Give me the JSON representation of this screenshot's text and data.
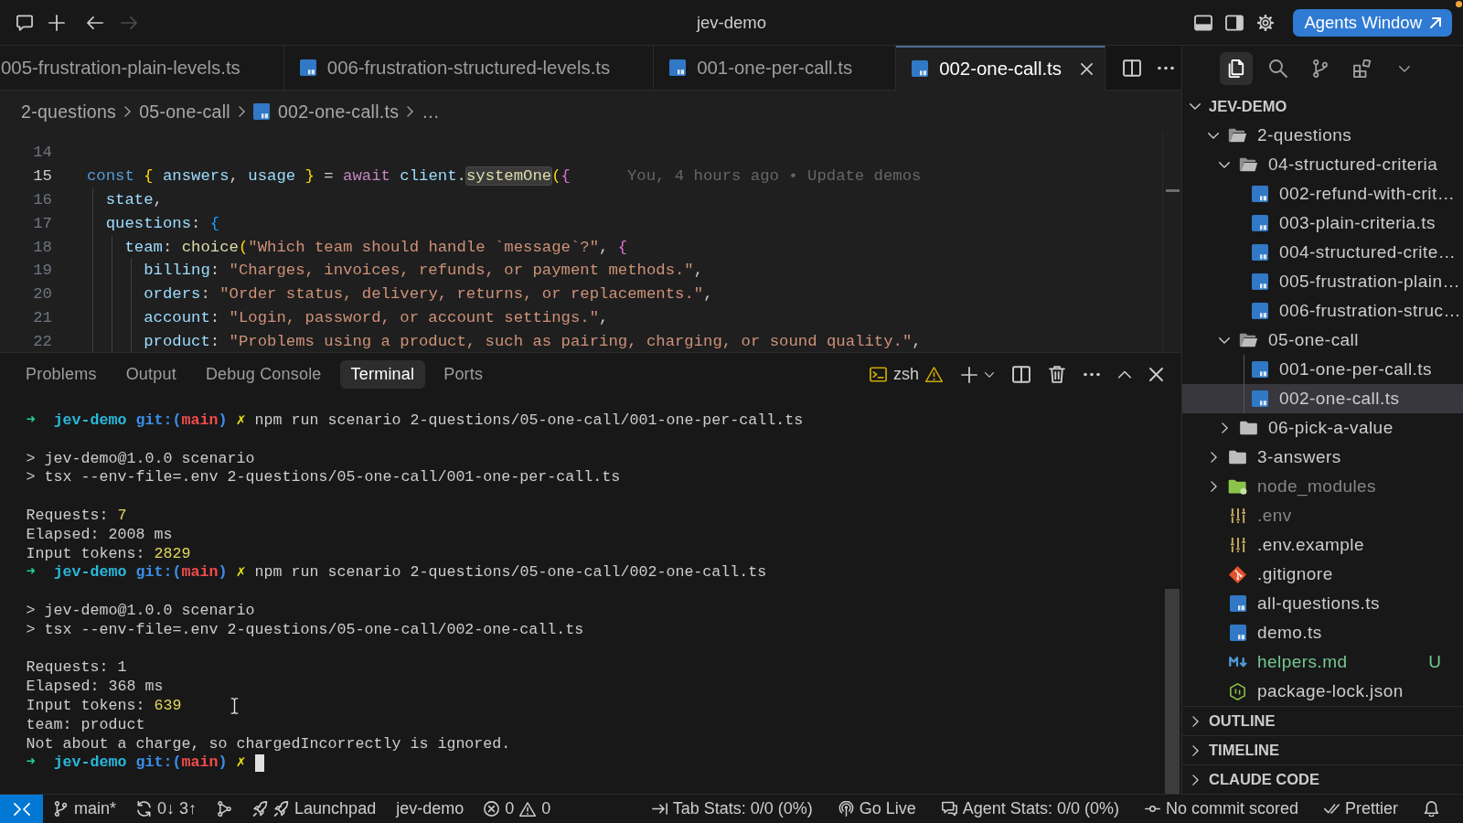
{
  "title_bar": {
    "left_actions": [
      {
        "kind": "chat",
        "disabled": false
      },
      {
        "kind": "new",
        "disabled": false
      },
      {
        "kind": "back",
        "disabled": false
      },
      {
        "kind": "forward",
        "disabled": true
      }
    ],
    "title": "jev-demo",
    "right_actions": [
      {
        "kind": "panel"
      },
      {
        "kind": "sidebar"
      },
      {
        "kind": "settings"
      }
    ],
    "agents_button": {
      "label": "Agents Window",
      "notification": true
    }
  },
  "editor": {
    "tabs": [
      {
        "label": "005-frustration-plain-levels.ts",
        "kind": "clipped",
        "selected": false
      },
      {
        "label": "006-frustration-structured-levels.ts",
        "kind": "file",
        "selected": false
      },
      {
        "label": "001-one-per-call.ts",
        "kind": "file",
        "selected": false
      },
      {
        "label": "002-one-call.ts",
        "kind": "file",
        "selected": true
      }
    ],
    "breadcrumbs": [
      {
        "label": "2-questions",
        "kind": "folder"
      },
      {
        "label": "05-one-call",
        "kind": "folder"
      },
      {
        "label": "002-one-call.ts",
        "kind": "file"
      },
      {
        "label": "…",
        "kind": "ellipsis"
      }
    ],
    "lines": [
      {
        "number": "14",
        "current": false
      },
      {
        "number": "15",
        "current": true,
        "tokens": [
          {
            "kind": "keyword",
            "text": "const "
          },
          {
            "kind": "bracket1",
            "text": "{"
          },
          {
            "kind": "variable",
            "text": " answers"
          },
          {
            "kind": "plain",
            "text": ", "
          },
          {
            "kind": "variable",
            "text": "usage "
          },
          {
            "kind": "bracket1",
            "text": "}"
          },
          {
            "kind": "plain",
            "text": " = "
          },
          {
            "kind": "control",
            "text": "await"
          },
          {
            "kind": "variable",
            "text": " client"
          },
          {
            "kind": "plain",
            "text": "."
          },
          {
            "kind": "match",
            "text": "systemOne"
          },
          {
            "kind": "bracket1",
            "text": "("
          },
          {
            "kind": "bracket2",
            "text": "{"
          }
        ],
        "blame": "You, 4 hours ago • Update demos"
      },
      {
        "number": "16",
        "current": false,
        "tokens": [
          {
            "kind": "variable",
            "text": "  state"
          },
          {
            "kind": "plain",
            "text": ","
          }
        ]
      },
      {
        "number": "17",
        "current": false,
        "tokens": [
          {
            "kind": "variable",
            "text": "  questions"
          },
          {
            "kind": "plain",
            "text": ": "
          },
          {
            "kind": "bracket3",
            "text": "{"
          }
        ]
      },
      {
        "number": "18",
        "current": false,
        "tokens": [
          {
            "kind": "variable",
            "text": "    team"
          },
          {
            "kind": "plain",
            "text": ": "
          },
          {
            "kind": "function",
            "text": "choice"
          },
          {
            "kind": "bracket1",
            "text": "("
          },
          {
            "kind": "string",
            "text": "\"Which team should handle `message`?\""
          },
          {
            "kind": "plain",
            "text": ", "
          },
          {
            "kind": "bracket2",
            "text": "{"
          }
        ]
      },
      {
        "number": "19",
        "current": false,
        "tokens": [
          {
            "kind": "variable",
            "text": "      billing"
          },
          {
            "kind": "plain",
            "text": ": "
          },
          {
            "kind": "string",
            "text": "\"Charges, invoices, refunds, or payment methods.\""
          },
          {
            "kind": "plain",
            "text": ","
          }
        ]
      },
      {
        "number": "20",
        "current": false,
        "tokens": [
          {
            "kind": "variable",
            "text": "      orders"
          },
          {
            "kind": "plain",
            "text": ": "
          },
          {
            "kind": "string",
            "text": "\"Order status, delivery, returns, or replacements.\""
          },
          {
            "kind": "plain",
            "text": ","
          }
        ]
      },
      {
        "number": "21",
        "current": false,
        "tokens": [
          {
            "kind": "variable",
            "text": "      account"
          },
          {
            "kind": "plain",
            "text": ": "
          },
          {
            "kind": "string",
            "text": "\"Login, password, or account settings.\""
          },
          {
            "kind": "plain",
            "text": ","
          }
        ]
      },
      {
        "number": "22",
        "current": false,
        "tokens": [
          {
            "kind": "variable",
            "text": "      product"
          },
          {
            "kind": "plain",
            "text": ": "
          },
          {
            "kind": "string",
            "text": "\"Problems using a product, such as pairing, charging, or sound quality.\""
          },
          {
            "kind": "plain",
            "text": ","
          }
        ]
      }
    ]
  },
  "panel": {
    "tabs": [
      {
        "label": "Problems",
        "selected": false
      },
      {
        "label": "Output",
        "selected": false
      },
      {
        "label": "Debug Console",
        "selected": false
      },
      {
        "label": "Terminal",
        "selected": true
      },
      {
        "label": "Ports",
        "selected": false
      }
    ],
    "terminal_profile": {
      "label": "zsh",
      "warning": true
    },
    "actions": [
      {
        "kind": "new"
      },
      {
        "kind": "launch-profile"
      },
      {
        "kind": "split"
      },
      {
        "kind": "trash"
      },
      {
        "kind": "more"
      },
      {
        "kind": "maximize"
      },
      {
        "kind": "close"
      }
    ],
    "terminal": {
      "lines": [
        {
          "kind": "prompt",
          "cursor": false,
          "parts": [
            {
              "kind": "arrow",
              "text": "➜"
            },
            {
              "kind": "dir",
              "text": "jev-demo"
            },
            {
              "kind": "git-open",
              "text": "git:("
            },
            {
              "kind": "branch",
              "text": "main"
            },
            {
              "kind": "git-close",
              "text": ")"
            },
            {
              "kind": "dirty",
              "text": "✗"
            },
            {
              "kind": "command",
              "text": "npm run scenario 2-questions/05-one-call/001-one-per-call.ts"
            }
          ]
        },
        {
          "kind": "blank"
        },
        {
          "kind": "text",
          "text": "> jev-demo@1.0.0 scenario"
        },
        {
          "kind": "text",
          "text": "> tsx --env-file=.env 2-questions/05-one-call/001-one-per-call.ts"
        },
        {
          "kind": "blank"
        },
        {
          "kind": "stat",
          "label": "Requests:",
          "value": "7",
          "highlight": true
        },
        {
          "kind": "stat",
          "label": "Elapsed:",
          "value": "2008 ms",
          "highlight": false
        },
        {
          "kind": "stat",
          "label": "Input tokens:",
          "value": "2829",
          "highlight": true
        },
        {
          "kind": "prompt",
          "cursor": false,
          "parts": [
            {
              "kind": "arrow",
              "text": "➜"
            },
            {
              "kind": "dir",
              "text": "jev-demo"
            },
            {
              "kind": "git-open",
              "text": "git:("
            },
            {
              "kind": "branch",
              "text": "main"
            },
            {
              "kind": "git-close",
              "text": ")"
            },
            {
              "kind": "dirty",
              "text": "✗"
            },
            {
              "kind": "command",
              "text": "npm run scenario 2-questions/05-one-call/002-one-call.ts"
            }
          ]
        },
        {
          "kind": "blank"
        },
        {
          "kind": "text",
          "text": "> jev-demo@1.0.0 scenario"
        },
        {
          "kind": "text",
          "text": "> tsx --env-file=.env 2-questions/05-one-call/002-one-call.ts"
        },
        {
          "kind": "blank"
        },
        {
          "kind": "stat",
          "label": "Requests:",
          "value": "1",
          "highlight": false
        },
        {
          "kind": "stat",
          "label": "Elapsed:",
          "value": "368 ms",
          "highlight": false
        },
        {
          "kind": "stat",
          "label": "Input tokens:",
          "value": "639",
          "highlight": true
        },
        {
          "kind": "text",
          "text": "team: product"
        },
        {
          "kind": "text",
          "text": "Not about a charge, so chargedIncorrectly is ignored."
        },
        {
          "kind": "prompt",
          "cursor": true,
          "parts": [
            {
              "kind": "arrow",
              "text": "➜"
            },
            {
              "kind": "dir",
              "text": "jev-demo"
            },
            {
              "kind": "git-open",
              "text": "git:("
            },
            {
              "kind": "branch",
              "text": "main"
            },
            {
              "kind": "git-close",
              "text": ")"
            },
            {
              "kind": "dirty",
              "text": "✗"
            }
          ]
        }
      ]
    }
  },
  "side_bar": {
    "activity": [
      {
        "kind": "explorer",
        "selected": true
      },
      {
        "kind": "search",
        "selected": false
      },
      {
        "kind": "source-control",
        "selected": false
      },
      {
        "kind": "extensions",
        "selected": false
      },
      {
        "kind": "more",
        "selected": false
      }
    ],
    "explorer": {
      "title": "JEV-DEMO",
      "expanded": true,
      "tree": [
        {
          "name": "2-questions",
          "kind": "folder",
          "expanded": true,
          "selected": false,
          "dimmed": false,
          "children": [
            {
              "name": "04-structured-criteria",
              "kind": "folder",
              "expanded": true,
              "selected": false,
              "dimmed": false,
              "children": [
                {
                  "name": "002-refund-with-crit…",
                  "kind": "ts",
                  "selected": false,
                  "dimmed": false
                },
                {
                  "name": "003-plain-criteria.ts",
                  "kind": "ts",
                  "selected": false,
                  "dimmed": false
                },
                {
                  "name": "004-structured-crite…",
                  "kind": "ts",
                  "selected": false,
                  "dimmed": false
                },
                {
                  "name": "005-frustration-plain…",
                  "kind": "ts",
                  "selected": false,
                  "dimmed": false
                },
                {
                  "name": "006-frustration-struc…",
                  "kind": "ts",
                  "selected": false,
                  "dimmed": false
                }
              ]
            },
            {
              "name": "05-one-call",
              "kind": "folder",
              "expanded": true,
              "selected": false,
              "dimmed": false,
              "children": [
                {
                  "name": "001-one-per-call.ts",
                  "kind": "ts",
                  "selected": false,
                  "dimmed": false
                },
                {
                  "name": "002-one-call.ts",
                  "kind": "ts",
                  "selected": true,
                  "dimmed": false
                }
              ]
            },
            {
              "name": "06-pick-a-value",
              "kind": "folder",
              "expanded": false,
              "selected": false,
              "dimmed": false
            }
          ]
        },
        {
          "name": "3-answers",
          "kind": "folder",
          "expanded": false,
          "selected": false,
          "dimmed": false
        },
        {
          "name": "node_modules",
          "kind": "node-folder",
          "expanded": false,
          "selected": false,
          "dimmed": true
        },
        {
          "name": ".env",
          "kind": "env",
          "selected": false,
          "dimmed": true
        },
        {
          "name": ".env.example",
          "kind": "env",
          "selected": false,
          "dimmed": false
        },
        {
          "name": ".gitignore",
          "kind": "git",
          "selected": false,
          "dimmed": false
        },
        {
          "name": "all-questions.ts",
          "kind": "ts",
          "selected": false,
          "dimmed": false
        },
        {
          "name": "demo.ts",
          "kind": "ts",
          "selected": false,
          "dimmed": false
        },
        {
          "name": "helpers.md",
          "kind": "markdown",
          "selected": false,
          "dimmed": false,
          "status": "U"
        },
        {
          "name": "package-lock.json",
          "kind": "npm-json",
          "selected": false,
          "dimmed": false
        }
      ]
    },
    "sections": [
      {
        "title": "OUTLINE",
        "expanded": false
      },
      {
        "title": "TIMELINE",
        "expanded": false
      },
      {
        "title": "CLAUDE CODE",
        "expanded": false
      }
    ]
  },
  "status_bar": {
    "left": [
      {
        "kind": "remote"
      },
      {
        "kind": "branch",
        "text": "main*"
      },
      {
        "kind": "sync",
        "text": "0↓ 3↑"
      },
      {
        "kind": "graph"
      },
      {
        "kind": "launchpad",
        "text": "Launchpad"
      },
      {
        "kind": "workspace",
        "text": "jev-demo"
      },
      {
        "kind": "problems",
        "errors": "0",
        "warnings": "0"
      }
    ],
    "right": [
      {
        "kind": "tab-stats",
        "text": "Tab Stats: 0/0 (0%)"
      },
      {
        "kind": "go-live",
        "text": "Go Live"
      },
      {
        "kind": "agent-stats",
        "text": "Agent Stats: 0/0 (0%)"
      },
      {
        "kind": "commit",
        "text": "No commit scored"
      },
      {
        "kind": "prettier",
        "text": "Prettier"
      },
      {
        "kind": "bell"
      }
    ]
  }
}
